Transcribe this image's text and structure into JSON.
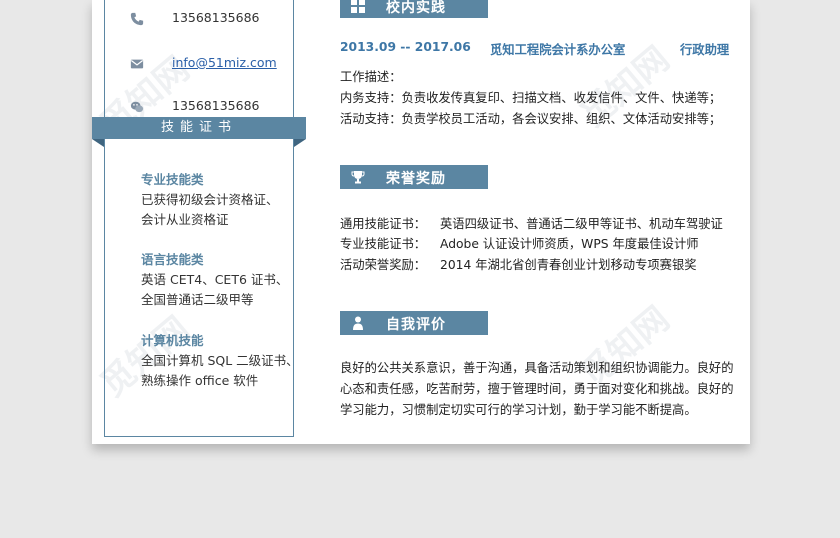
{
  "contact": {
    "phone": "13568135686",
    "email": "info@51miz.com",
    "wechat": "13568135686"
  },
  "skills_section": {
    "title": "技能证书",
    "groups": [
      {
        "category": "专业技能类",
        "lines": [
          "已获得初级会计资格证、",
          "会计从业资格证"
        ]
      },
      {
        "category": "语言技能类",
        "lines": [
          "英语 CET4、CET6 证书、",
          "全国普通话二级甲等"
        ]
      },
      {
        "category": "计算机技能",
        "lines": [
          "全国计算机 SQL 二级证书、",
          "熟练操作 office 软件"
        ]
      }
    ]
  },
  "practice": {
    "title": "校内实践",
    "period": "2013.09 -- 2017.06",
    "org": "觅知工程院会计系办公室",
    "role": "行政助理",
    "desc_label": "工作描述：",
    "items": [
      "内务支持：负责收发传真复印、扫描文档、收发信件、文件、快递等；",
      "活动支持：负责学校员工活动，各会议安排、组织、文体活动安排等；"
    ]
  },
  "honors": {
    "title": "荣誉奖励",
    "rows": [
      {
        "label": "通用技能证书：",
        "value": "英语四级证书、普通话二级甲等证书、机动车驾驶证"
      },
      {
        "label": "专业技能证书：",
        "value": "Adobe 认证设计师资质，WPS 年度最佳设计师"
      },
      {
        "label": "活动荣誉奖励：",
        "value": "2014 年湖北省创青春创业计划移动专项赛银奖"
      }
    ]
  },
  "self_eval": {
    "title": "自我评价",
    "lines": [
      "良好的公共关系意识，善于沟通，具备活动策划和组织协调能力。良好的",
      "心态和责任感，吃苦耐劳，擅于管理时间，勇于面对变化和挑战。良好的",
      "学习能力，习惯制定切实可行的学习计划，勤于学习能不断提高。"
    ]
  },
  "watermark": "觅知网",
  "colors": {
    "accent": "#5b86a2",
    "date_blue": "#3e77a6",
    "link": "#2a5fa8"
  }
}
